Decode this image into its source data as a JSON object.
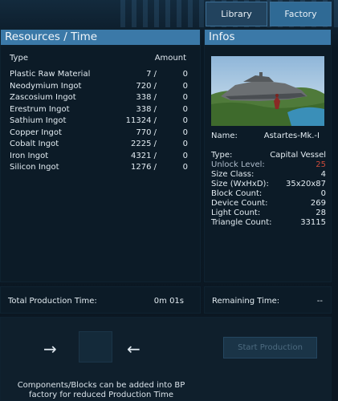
{
  "tabs": {
    "library": "Library",
    "factory": "Factory"
  },
  "resources": {
    "title": "Resources / Time",
    "col_type": "Type",
    "col_amount": "Amount",
    "items": [
      {
        "name": "Plastic Raw Material",
        "qty": "7 /",
        "amount": "0"
      },
      {
        "name": "Neodymium Ingot",
        "qty": "720 /",
        "amount": "0"
      },
      {
        "name": "Zascosium Ingot",
        "qty": "338 /",
        "amount": "0"
      },
      {
        "name": "Erestrum Ingot",
        "qty": "338 /",
        "amount": "0"
      },
      {
        "name": "Sathium Ingot",
        "qty": "11324 /",
        "amount": "0"
      },
      {
        "name": "Copper Ingot",
        "qty": "770 /",
        "amount": "0"
      },
      {
        "name": "Cobalt Ingot",
        "qty": "2225 /",
        "amount": "0"
      },
      {
        "name": "Iron Ingot",
        "qty": "4321 /",
        "amount": "0"
      },
      {
        "name": "Silicon Ingot",
        "qty": "1276 /",
        "amount": "0"
      }
    ]
  },
  "infos": {
    "title": "Infos",
    "name_label": "Name:",
    "name_value": "Astartes-Mk.-I",
    "type_label": "Type:",
    "type_value": "Capital Vessel",
    "unlock_label": "Unlock Level:",
    "unlock_value": "25",
    "size_class_label": "Size Class:",
    "size_class_value": "4",
    "size_label": "Size (WxHxD):",
    "size_value": "35x20x87",
    "block_label": "Block Count:",
    "block_value": "0",
    "device_label": "Device Count:",
    "device_value": "269",
    "light_label": "Light Count:",
    "light_value": "28",
    "triangle_label": "Triangle Count:",
    "triangle_value": "33115"
  },
  "production": {
    "total_label": "Total Production Time:",
    "total_value": "0m 01s",
    "remaining_label": "Remaining Time:",
    "remaining_value": "--",
    "start_label": "Start Production",
    "note_line1": "Components/Blocks can be added into BP",
    "note_line2": "factory for reduced Production Time",
    "arrow_right_icon": "arrow-right-icon",
    "arrow_left_icon": "arrow-left-icon"
  },
  "colors": {
    "header": "#3b79a8",
    "unlock_level": "#c94a3a"
  }
}
